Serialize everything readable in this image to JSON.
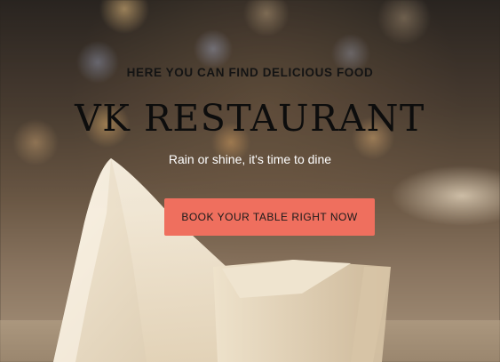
{
  "hero": {
    "tagline": "HERE YOU CAN FIND DELICIOUS FOOD",
    "title": "VK RESTAURANT",
    "subtitle": "Rain or shine, it's time to dine",
    "cta_label": "BOOK YOUR TABLE RIGHT NOW"
  },
  "colors": {
    "accent": "#ef6f5e",
    "heading_text": "#0d0d0d",
    "subtitle_text": "#ffffff"
  }
}
